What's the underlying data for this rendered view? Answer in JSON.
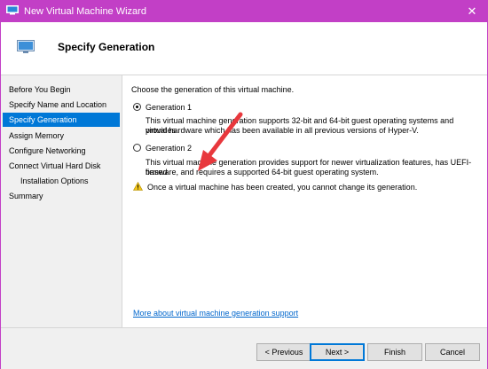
{
  "window": {
    "title": "New Virtual Machine Wizard",
    "close_symbol": "✕"
  },
  "header": {
    "title": "Specify Generation",
    "icon": "virtual-machine-icon"
  },
  "nav": {
    "items": [
      {
        "label": "Before You Begin"
      },
      {
        "label": "Specify Name and Location"
      },
      {
        "label": "Specify Generation"
      },
      {
        "label": "Assign Memory"
      },
      {
        "label": "Configure Networking"
      },
      {
        "label": "Connect Virtual Hard Disk"
      },
      {
        "label": "Installation Options"
      },
      {
        "label": "Summary"
      }
    ],
    "active_index": 2
  },
  "content": {
    "prompt": "Choose the generation of this virtual machine.",
    "gen1": {
      "label": "Generation 1",
      "checked": true,
      "desc_line1": "This virtual machine generation supports 32-bit and 64-bit guest operating systems and provides",
      "desc_line2": "virtual hardware which has been available in all previous versions of Hyper-V."
    },
    "gen2": {
      "label": "Generation 2",
      "checked": false,
      "desc_line1": "This virtual machine generation provides support for newer virtualization features, has UEFI-based",
      "desc_line2": "firmware, and requires a supported 64-bit guest operating system."
    },
    "warning": "Once a virtual machine has been created, you cannot change its generation.",
    "link": "More about virtual machine generation support"
  },
  "footer": {
    "previous": "< Previous",
    "next": "Next >",
    "finish": "Finish",
    "cancel": "Cancel"
  },
  "colors": {
    "titlebar": "#c23fc6",
    "selection": "#0078d7",
    "annotation_arrow": "#e8383d",
    "link": "#0066cc"
  }
}
